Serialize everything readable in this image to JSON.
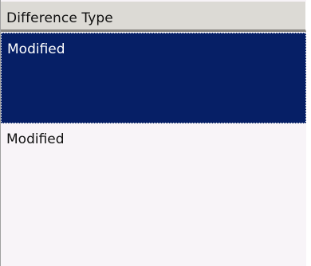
{
  "grid": {
    "column_header": "Difference Type",
    "rows": [
      {
        "value": "Modified",
        "selected": true
      },
      {
        "value": "Modified",
        "selected": false
      }
    ]
  },
  "colors": {
    "header_bg": "#dcdad5",
    "selection_bg": "#061f66",
    "row_bg": "#f8f4f8"
  }
}
